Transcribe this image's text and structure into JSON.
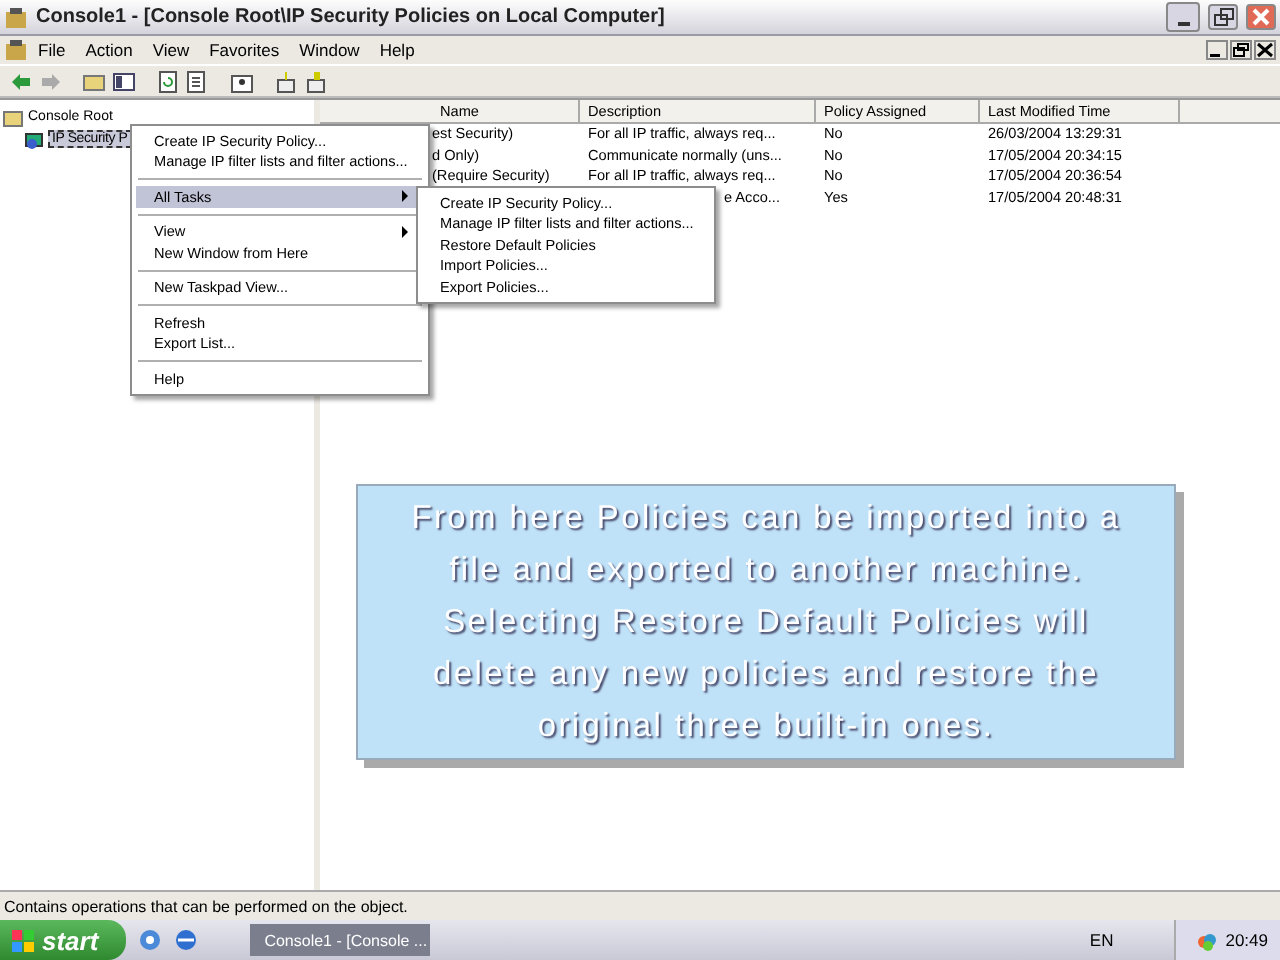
{
  "window": {
    "title": "Console1 - [Console Root\\IP Security Policies on Local Computer]"
  },
  "menu_bar": [
    "File",
    "Action",
    "View",
    "Favorites",
    "Window",
    "Help"
  ],
  "tree": [
    {
      "label": "Console Root",
      "selected": false,
      "children": [
        {
          "label": "IP Security P",
          "selected": true
        }
      ]
    }
  ],
  "table": {
    "columns": [
      "Name",
      "Description",
      "Policy Assigned",
      "Last Modified Time"
    ],
    "rows": [
      {
        "name": "est Security)",
        "description": "For all IP traffic, always req...",
        "assigned": "No",
        "modified": "26/03/2004 13:29:31"
      },
      {
        "name": "d Only)",
        "description": "Communicate normally (uns...",
        "assigned": "No",
        "modified": "17/05/2004 20:34:15"
      },
      {
        "name": "(Require Security)",
        "description": "For all IP traffic, always req...",
        "assigned": "No",
        "modified": "17/05/2004 20:36:54"
      },
      {
        "description": "e Acco...",
        "assigned": "Yes",
        "modified": "17/05/2004 20:48:31"
      }
    ]
  },
  "context_menu": [
    [
      {
        "label": "Create IP Security Policy...",
        "selected": false,
        "submenu": false
      },
      {
        "label": "Manage IP filter lists and filter actions...",
        "selected": false,
        "submenu": false
      }
    ],
    [
      {
        "label": "All Tasks",
        "selected": true,
        "submenu": true
      }
    ],
    [
      {
        "label": "View",
        "selected": false,
        "submenu": true
      },
      {
        "label": "New Window from Here",
        "selected": false,
        "submenu": false
      }
    ],
    [
      {
        "label": "New Taskpad View...",
        "selected": false,
        "submenu": false
      }
    ],
    [
      {
        "label": "Refresh",
        "selected": false,
        "submenu": false
      },
      {
        "label": "Export List...",
        "selected": false,
        "submenu": false
      }
    ],
    [
      {
        "label": "Help",
        "selected": false,
        "submenu": false
      }
    ]
  ],
  "submenu": [
    "Create IP Security Policy...",
    "Manage IP filter lists and filter actions...",
    "Restore Default Policies",
    "Import Policies...",
    "Export Policies..."
  ],
  "callout": "From here Policies can be imported into a file and exported to another machine. Selecting Restore Default Policies will delete any new policies and restore the original three built-in ones.",
  "status_bar": "Contains operations that can be performed on the object.",
  "taskbar": {
    "start": "start",
    "task": "Console1 - [Console ...",
    "language": "EN",
    "clock": "20:49"
  }
}
